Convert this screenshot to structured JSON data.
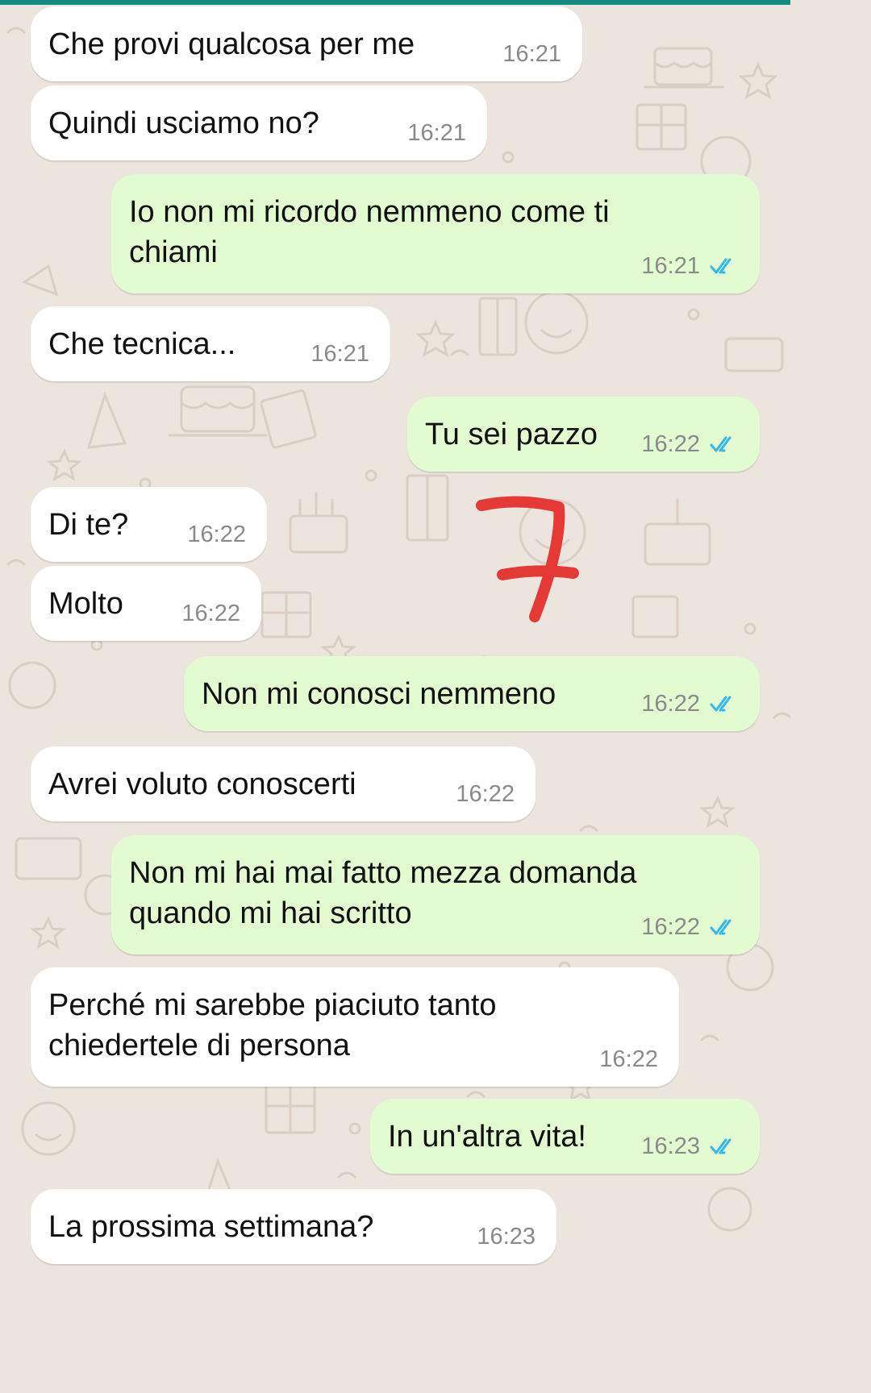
{
  "theme": {
    "incoming_bubble": "#ffffff",
    "outgoing_bubble": "#e3fbd1",
    "wallpaper": "#ece5dd",
    "read_ticks": "#34b7f1",
    "time_text": "#8a8a8a"
  },
  "messages": [
    {
      "text": "Che provi qualcosa per me",
      "time": "16:21",
      "direction": "in"
    },
    {
      "text": "Quindi usciamo no?",
      "time": "16:21",
      "direction": "in"
    },
    {
      "text": "Io non mi ricordo nemmeno come ti\nchiami",
      "time": "16:21",
      "direction": "out",
      "status_icon": "double-check-read-icon"
    },
    {
      "text": "Che tecnica...",
      "time": "16:21",
      "direction": "in"
    },
    {
      "text": "Tu sei pazzo",
      "time": "16:22",
      "direction": "out",
      "status_icon": "double-check-read-icon"
    },
    {
      "text": "Di te?",
      "time": "16:22",
      "direction": "in"
    },
    {
      "text": "Molto",
      "time": "16:22",
      "direction": "in"
    },
    {
      "text": "Non mi conosci nemmeno",
      "time": "16:22",
      "direction": "out",
      "status_icon": "double-check-read-icon"
    },
    {
      "text": "Avrei voluto conoscerti",
      "time": "16:22",
      "direction": "in"
    },
    {
      "text": "Non mi hai mai fatto mezza domanda\nquando mi hai scritto",
      "time": "16:22",
      "direction": "out",
      "status_icon": "double-check-read-icon"
    },
    {
      "text": "Perché mi sarebbe piaciuto tanto\nchiedertele di persona",
      "time": "16:22",
      "direction": "in"
    },
    {
      "text": "In un'altra vita!",
      "time": "16:23",
      "direction": "out",
      "status_icon": "double-check-read-icon"
    },
    {
      "text": "La prossima settimana?",
      "time": "16:23",
      "direction": "in"
    }
  ],
  "annotation": {
    "icon": "red-seven-handwritten-mark",
    "color": "#e53935"
  }
}
